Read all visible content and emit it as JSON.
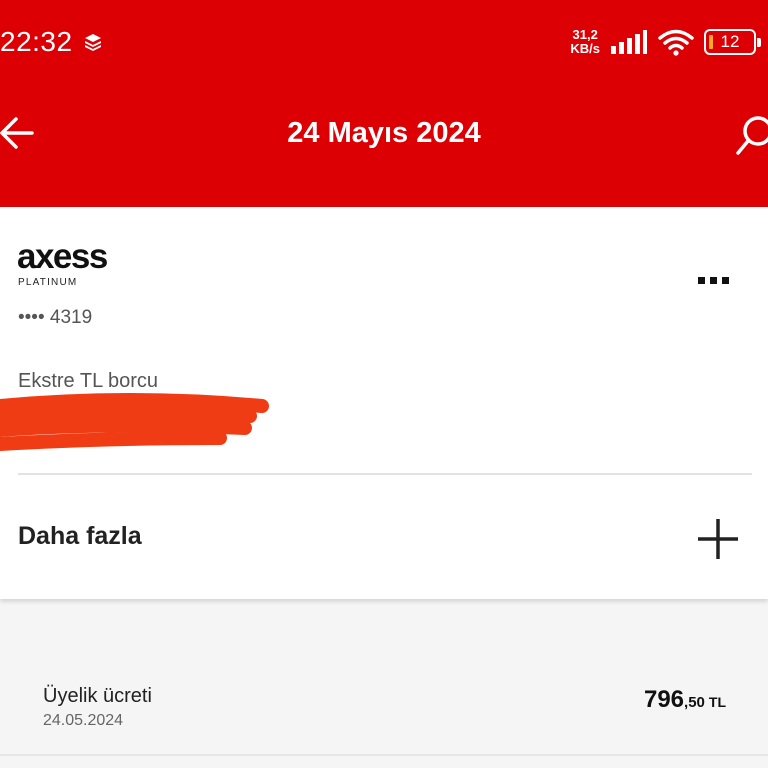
{
  "status_bar": {
    "time": "22:32",
    "net_speed_value": "31,2",
    "net_speed_unit": "KB/s",
    "battery": "12"
  },
  "header": {
    "title": "24 Mayıs 2024"
  },
  "card": {
    "brand": "axess",
    "tier": "PLATINUM",
    "number": "•••• 4319",
    "statement_label": "Ekstre TL borcu",
    "more_label": "Daha fazla"
  },
  "transactions": [
    {
      "name": "Üyelik ücreti",
      "date": "24.05.2024",
      "amount_int": "796",
      "amount_dec": ",50",
      "currency": "TL"
    }
  ],
  "colors": {
    "header_bg": "#dc0005",
    "redaction": "#f03c14"
  }
}
